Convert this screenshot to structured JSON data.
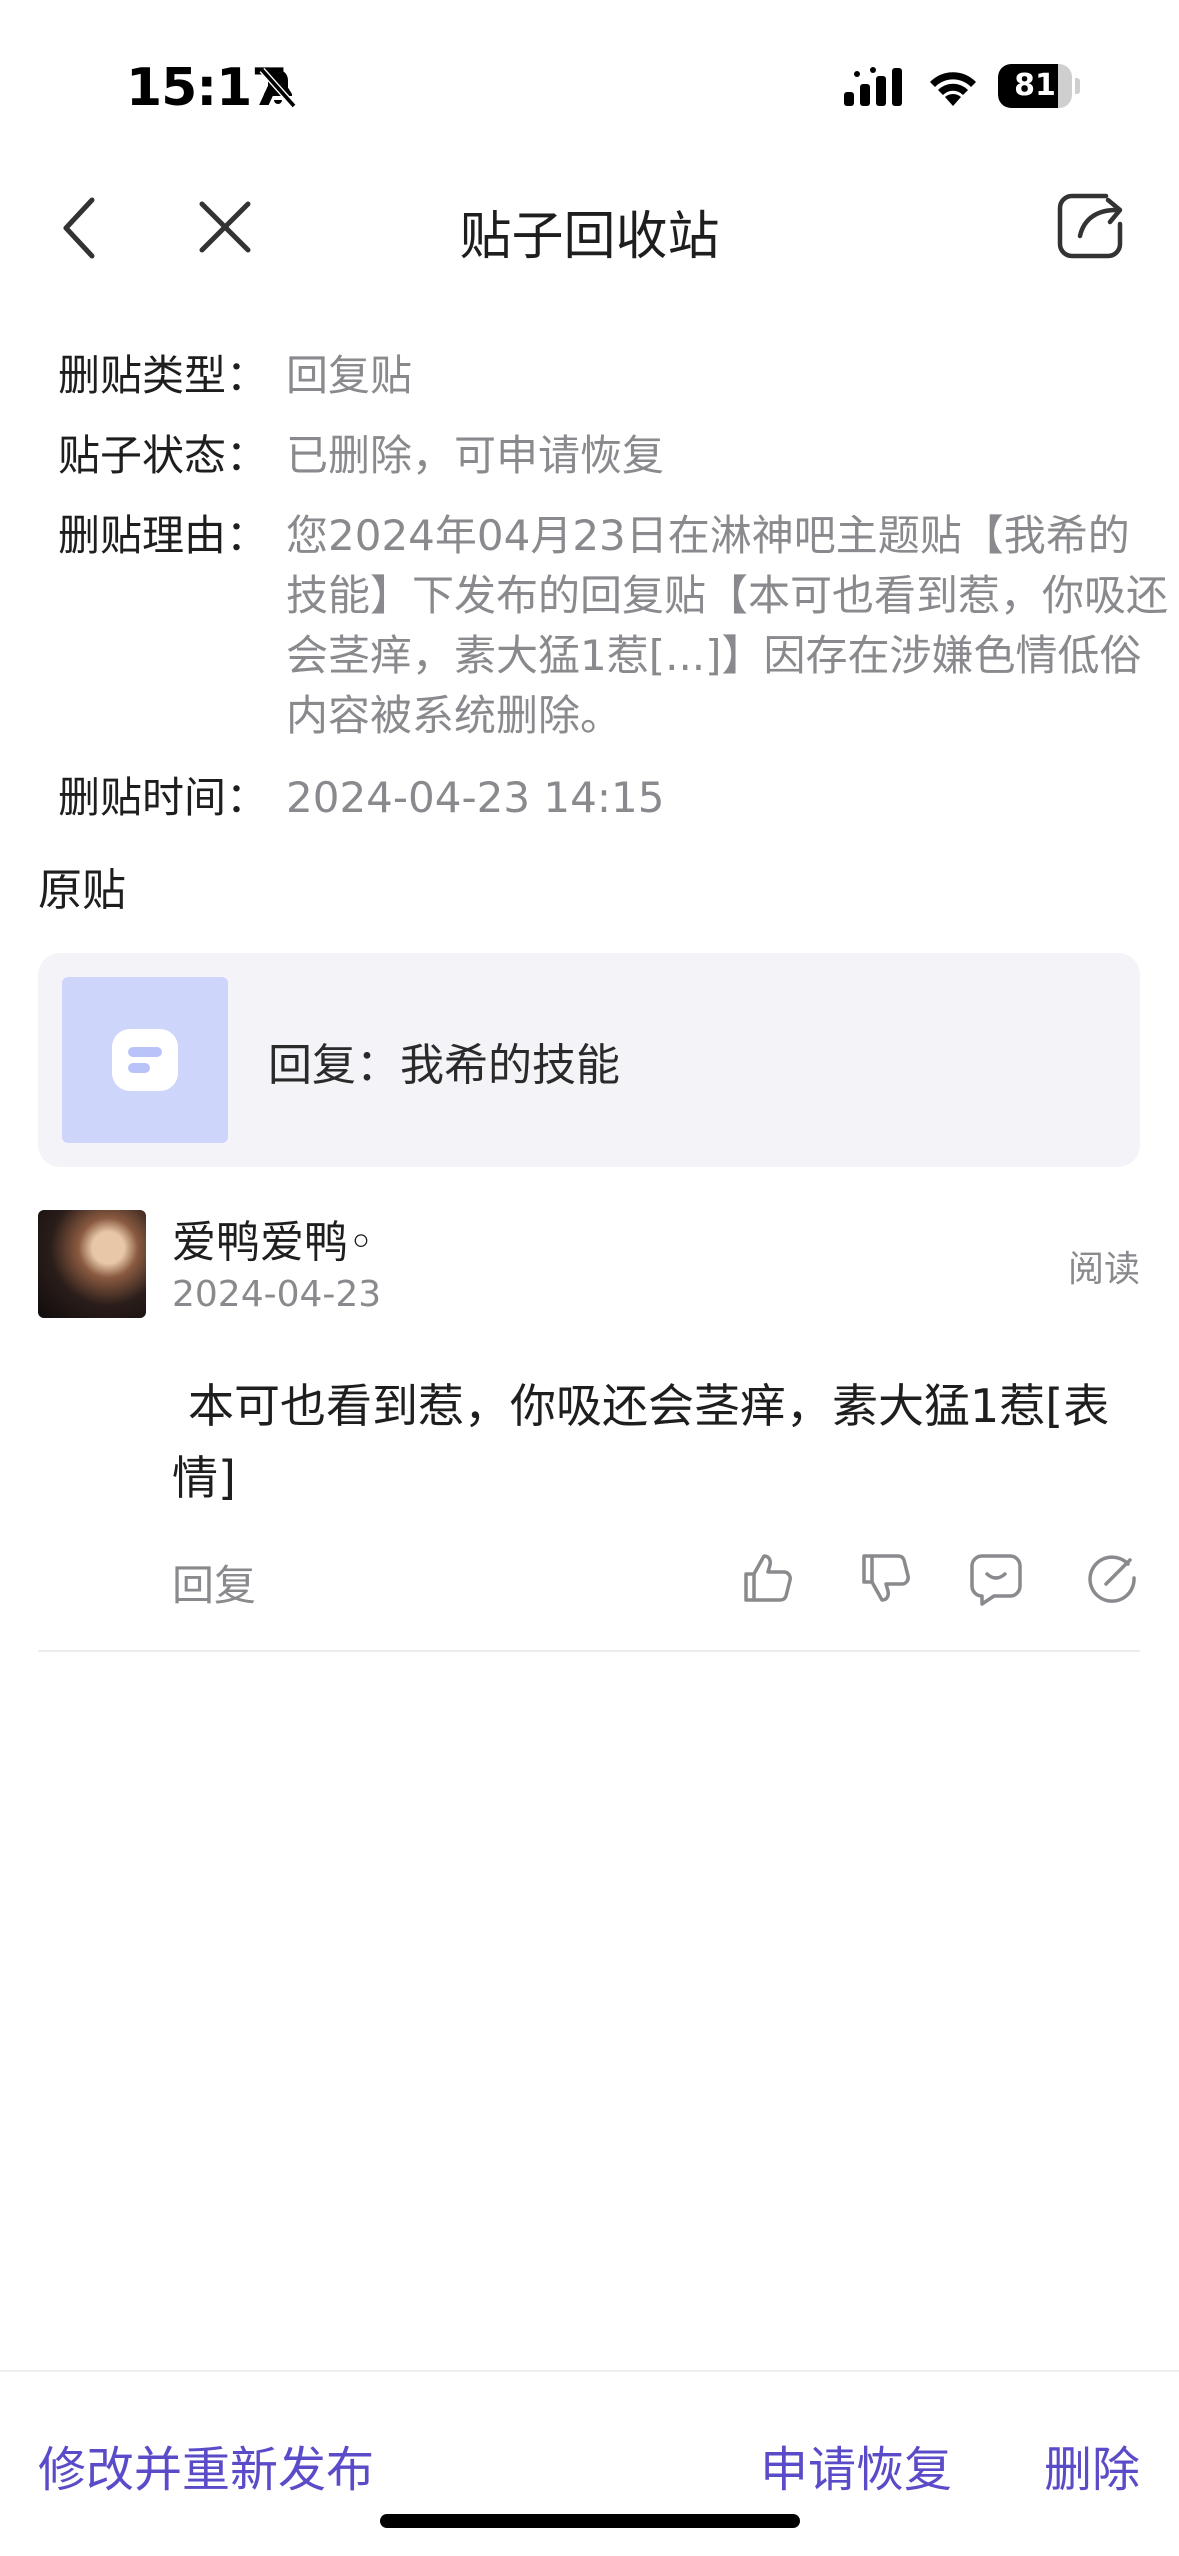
{
  "status_bar": {
    "time": "15:17",
    "battery": "81",
    "battery_level": 0.81
  },
  "nav": {
    "title": "贴子回收站"
  },
  "info": {
    "type_label": "删贴类型：",
    "type_value": "回复贴",
    "status_label": "贴子状态：",
    "status_value": "已删除，可申请恢复",
    "reason_label": "删贴理由：",
    "reason_value": "您2024年04月23日在淋神吧主题贴【我希的技能】下发布的回复贴【本可也看到惹，你吸还会茎痒，素大猛1惹[...]】因存在涉嫌色情低俗内容被系统删除。",
    "time_label": "删贴时间：",
    "time_value": "2024-04-23 14:15"
  },
  "original": {
    "section_title": "原贴",
    "card_text": "回复：我希的技能"
  },
  "post": {
    "username": "爱鸭爱鸭◦",
    "date": "2024-04-23",
    "read_label": "阅读",
    "content": "本可也看到惹，你吸还会茎痒，素大猛1惹[表情]",
    "reply_label": "回复"
  },
  "bottom": {
    "republish": "修改并重新发布",
    "restore": "申请恢复",
    "delete": "删除"
  },
  "colors": {
    "accent": "#5a4bc8",
    "secondary_text": "#8a8a8e",
    "card_bg": "#f4f4f8"
  }
}
